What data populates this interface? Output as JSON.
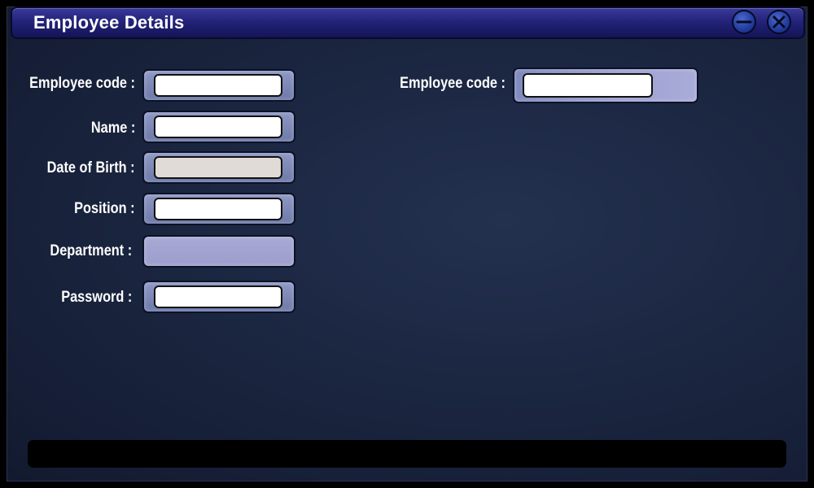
{
  "window": {
    "title": "Employee Details",
    "buttons": {
      "minimize_icon": "minus-circle",
      "close_icon": "x-circle"
    }
  },
  "form": {
    "employee_code": {
      "label": "Employee code :",
      "value": ""
    },
    "name": {
      "label": "Name :",
      "value": ""
    },
    "date_of_birth": {
      "label": "Date of Birth :",
      "value": ""
    },
    "position": {
      "label": "Position :",
      "value": ""
    },
    "department": {
      "label": "Department :",
      "value": ""
    },
    "password": {
      "label": "Password :",
      "value": ""
    }
  },
  "search": {
    "employee_code": {
      "label": "Employee code :",
      "value": ""
    }
  },
  "status": {
    "text": ""
  },
  "colors": {
    "title_bar": "#23237a",
    "background": "#1b2641",
    "field_frame": "#7f8abd",
    "button": "#243fa0"
  }
}
